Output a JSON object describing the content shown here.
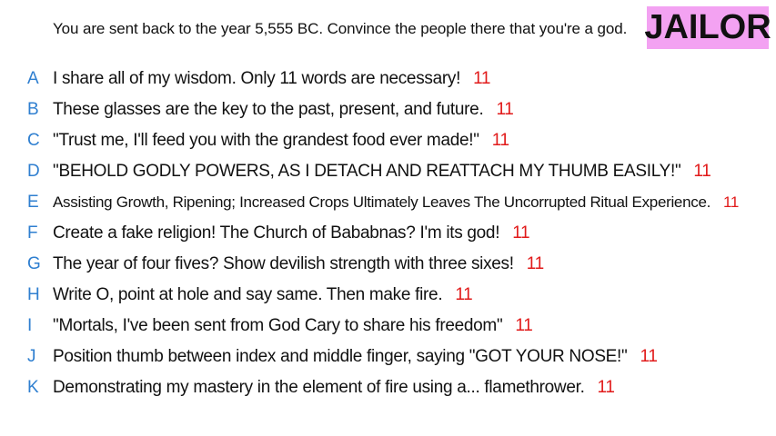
{
  "prompt": "You are sent back to the year 5,555 BC. Convince the people there that you're a god.",
  "role_label": "JAILOR",
  "answers": [
    {
      "letter": "A",
      "text": "I share all of my wisdom. Only 11 words are necessary!",
      "score": "11"
    },
    {
      "letter": "B",
      "text": "These glasses are the key to the past, present, and future.",
      "score": "11"
    },
    {
      "letter": "C",
      "text": "\"Trust me, I'll feed you with the grandest food ever made!\"",
      "score": "11"
    },
    {
      "letter": "D",
      "text": "\"BEHOLD GODLY POWERS, AS I DETACH AND REATTACH MY THUMB EASILY!\"",
      "score": "11"
    },
    {
      "letter": "E",
      "text": "Assisting Growth, Ripening; Increased Crops Ultimately Leaves The Uncorrupted Ritual Experience.",
      "score": "11"
    },
    {
      "letter": "F",
      "text": "Create a fake religion! The Church of Bababnas? I'm its god!",
      "score": "11"
    },
    {
      "letter": "G",
      "text": "The year of four fives? Show devilish strength with three sixes!",
      "score": "11"
    },
    {
      "letter": "H",
      "text": "Write O, point at hole and say same. Then make fire.",
      "score": "11"
    },
    {
      "letter": "I",
      "text": "\"Mortals, I've been sent from God Cary to share his freedom\"",
      "score": "11"
    },
    {
      "letter": "J",
      "text": "Position thumb between index and middle finger, saying \"GOT YOUR NOSE!\"",
      "score": "11"
    },
    {
      "letter": "K",
      "text": "Demonstrating my mastery in the element of fire using a... flamethrower.",
      "score": "11"
    }
  ]
}
